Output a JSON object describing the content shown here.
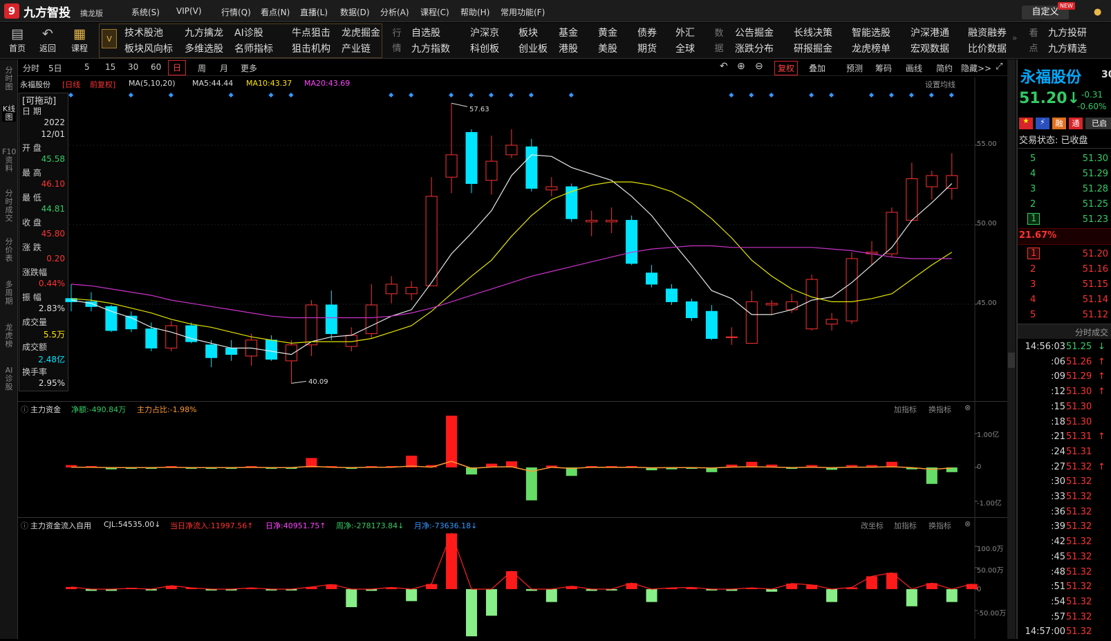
{
  "app": {
    "name": "九方智投",
    "edition": "擒龙版",
    "custom": "自定义",
    "new_badge": "NEW",
    "menus": [
      "系统(S)",
      "VIP(V)",
      "行情(Q)",
      "看点(N)",
      "直播(L)",
      "数据(D)",
      "分析(A)",
      "课程(C)",
      "帮助(H)",
      "常用功能(F)"
    ]
  },
  "toolbar": {
    "home": "首页",
    "back": "返回",
    "course": "课程",
    "group1": [
      "技术股池",
      "九方擒龙",
      "AI诊股",
      "牛点狙击",
      "龙虎掘金",
      "板块风向标",
      "多维选股",
      "名师指标",
      "狙击机构",
      "产业链"
    ],
    "quote_label": "行情",
    "group2": [
      "自选股",
      "沪深京",
      "板块",
      "基金",
      "黄金",
      "债券",
      "外汇",
      "九方指数",
      "科创板",
      "创业板",
      "港股",
      "美股",
      "期货",
      "全球"
    ],
    "data_label": "数据",
    "group3": [
      "公告掘金",
      "长线决策",
      "智能选股",
      "沪深港通",
      "融资融券",
      "涨跌分布",
      "研报掘金",
      "龙虎榜单",
      "宏观数据",
      "比价数据"
    ],
    "view_label": "看点",
    "group4": [
      "九方投研",
      "九方精选"
    ]
  },
  "chart_toolbar": {
    "periods": [
      "分时",
      "5日",
      "5",
      "15",
      "30",
      "60",
      "日",
      "周",
      "月",
      "更多"
    ],
    "tools": [
      "复权",
      "叠加",
      "预测",
      "筹码",
      "画线",
      "简约",
      "隐藏>>"
    ]
  },
  "left_nav": [
    "分时图",
    "K线图",
    "F10资料",
    "分时成交",
    "分价表",
    "多周期",
    "龙虎榜",
    "AI诊股"
  ],
  "kline": {
    "stock": "永福股份",
    "period": "[日线",
    "adj": "前复权]",
    "ma_label": "MA(5,10,20)",
    "ma5": "MA5:44.44",
    "ma10": "MA10:43.37",
    "ma20": "MA20:43.69",
    "settings": "设置均线",
    "high_label": "57.63",
    "low_label": "40.09",
    "y_ticks": [
      "55.00",
      "50.00",
      "45.00"
    ]
  },
  "info": {
    "drag": "[可拖动]",
    "date_label": "日 期",
    "year": "2022",
    "date": "12/01",
    "open_label": "开 盘",
    "open": "45.58",
    "high_label": "最 高",
    "high": "46.10",
    "low_label": "最 低",
    "low": "44.81",
    "close_label": "收 盘",
    "close": "45.80",
    "change_label": "涨 跌",
    "change": "0.20",
    "pct_label": "涨跌幅",
    "pct": "0.44%",
    "amp_label": "振 幅",
    "amp": "2.83%",
    "vol_label": "成交量",
    "vol": "5.5万",
    "amt_label": "成交额",
    "amt": "2.48亿",
    "turn_label": "换手率",
    "turn": "2.95%"
  },
  "panel1": {
    "title": "主力资金",
    "net": "净额:-490.84万",
    "ratio": "主力占比:-1.98%",
    "add": "加指标",
    "switch": "换指标",
    "y_ticks": [
      "1.00亿",
      "0",
      "-1.00亿"
    ]
  },
  "panel2": {
    "title": "主力资金流入自用",
    "cjl": "CJL:54535.00↓",
    "today": "当日净流入:11997.56↑",
    "day": "日净:40951.75↑",
    "week": "周净:-278173.84↓",
    "month": "月净:-73636.18↓",
    "coord": "改坐标",
    "add": "加指标",
    "switch": "换指标",
    "y_ticks": [
      "100.0万",
      "50.00万",
      "0",
      "-50.00万"
    ]
  },
  "quote": {
    "name": "永福股份",
    "code": "30",
    "price": "51.20↓",
    "chg": "-0.31",
    "pct": "-0.60%",
    "status": "交易状态: 已收盘",
    "commission": "21.67%",
    "sub_title": "分时成交",
    "flags": [
      "",
      "",
      "融",
      "通",
      "已启"
    ],
    "asks": [
      {
        "n": "5",
        "p": "51.30"
      },
      {
        "n": "4",
        "p": "51.29"
      },
      {
        "n": "3",
        "p": "51.28"
      },
      {
        "n": "2",
        "p": "51.25"
      },
      {
        "n": "1",
        "p": "51.23"
      }
    ],
    "bids": [
      {
        "n": "1",
        "p": "51.20"
      },
      {
        "n": "2",
        "p": "51.16"
      },
      {
        "n": "3",
        "p": "51.15"
      },
      {
        "n": "4",
        "p": "51.14"
      },
      {
        "n": "5",
        "p": "51.12"
      }
    ],
    "ticks": [
      {
        "t": "14:56:03",
        "p": "51.25",
        "a": "↓",
        "c": "green"
      },
      {
        "t": ":06",
        "p": "51.26",
        "a": "↑",
        "c": "red"
      },
      {
        "t": ":09",
        "p": "51.29",
        "a": "↑",
        "c": "red"
      },
      {
        "t": ":12",
        "p": "51.30",
        "a": "↑",
        "c": "red"
      },
      {
        "t": ":15",
        "p": "51.30",
        "a": "",
        "c": "red"
      },
      {
        "t": ":18",
        "p": "51.30",
        "a": "",
        "c": "red"
      },
      {
        "t": ":21",
        "p": "51.31",
        "a": "↑",
        "c": "red"
      },
      {
        "t": ":24",
        "p": "51.31",
        "a": "",
        "c": "red"
      },
      {
        "t": ":27",
        "p": "51.32",
        "a": "↑",
        "c": "red"
      },
      {
        "t": ":30",
        "p": "51.32",
        "a": "",
        "c": "red"
      },
      {
        "t": ":33",
        "p": "51.32",
        "a": "",
        "c": "red"
      },
      {
        "t": ":36",
        "p": "51.32",
        "a": "",
        "c": "red"
      },
      {
        "t": ":39",
        "p": "51.32",
        "a": "",
        "c": "red"
      },
      {
        "t": ":42",
        "p": "51.32",
        "a": "",
        "c": "red"
      },
      {
        "t": ":45",
        "p": "51.32",
        "a": "",
        "c": "red"
      },
      {
        "t": ":48",
        "p": "51.32",
        "a": "",
        "c": "red"
      },
      {
        "t": ":51",
        "p": "51.32",
        "a": "",
        "c": "red"
      },
      {
        "t": ":54",
        "p": "51.32",
        "a": "",
        "c": "red"
      },
      {
        "t": ":57",
        "p": "51.32",
        "a": "",
        "c": "red"
      },
      {
        "t": "14:57:00",
        "p": "51.32",
        "a": "",
        "c": "red"
      }
    ]
  },
  "chart_data": {
    "type": "candlestick",
    "candles": [
      [
        45.4,
        45.2,
        46.3,
        44.6
      ],
      [
        45.2,
        44.9,
        45.8,
        44.6
      ],
      [
        44.9,
        43.4,
        45.0,
        43.3
      ],
      [
        44.3,
        43.5,
        44.6,
        43.3
      ],
      [
        43.5,
        42.3,
        43.9,
        42.1
      ],
      [
        42.3,
        43.7,
        44.0,
        42.1
      ],
      [
        43.7,
        42.7,
        43.9,
        42.6
      ],
      [
        42.5,
        41.7,
        42.8,
        41.1
      ],
      [
        42.3,
        41.9,
        42.8,
        41.5
      ],
      [
        41.8,
        42.8,
        43.2,
        41.2
      ],
      [
        42.8,
        41.6,
        43.1,
        41.5
      ],
      [
        41.5,
        42.5,
        42.8,
        40.09
      ],
      [
        42.5,
        45.0,
        45.3,
        41.8
      ],
      [
        45.0,
        43.2,
        45.9,
        42.8
      ],
      [
        42.4,
        43.1,
        43.6,
        42.1
      ],
      [
        43.2,
        45.0,
        46.3,
        42.9
      ],
      [
        45.7,
        46.3,
        46.8,
        45.1
      ],
      [
        45.7,
        46.1,
        46.5,
        45.3
      ],
      [
        46.2,
        51.8,
        53.0,
        46.2
      ],
      [
        53.0,
        54.4,
        57.63,
        52.0
      ],
      [
        55.8,
        52.6,
        56.0,
        52.0
      ],
      [
        52.8,
        54.0,
        55.6,
        51.9
      ],
      [
        54.4,
        55.0,
        56.0,
        54.2
      ],
      [
        54.9,
        52.3,
        55.4,
        52.1
      ],
      [
        52.2,
        52.4,
        53.0,
        51.8
      ],
      [
        52.4,
        50.4,
        52.6,
        50.2
      ],
      [
        50.2,
        50.3,
        50.9,
        49.3
      ],
      [
        50.2,
        50.3,
        51.1,
        49.5
      ],
      [
        50.3,
        47.6,
        50.6,
        47.5
      ],
      [
        47.0,
        46.3,
        47.5,
        46.1
      ],
      [
        46.0,
        45.2,
        46.3,
        45.0
      ],
      [
        45.2,
        44.2,
        45.4,
        44.0
      ],
      [
        44.6,
        42.9,
        45.0,
        42.8
      ],
      [
        43.0,
        43.0,
        43.6,
        42.5
      ],
      [
        42.6,
        45.2,
        45.9,
        42.6
      ],
      [
        45.0,
        45.1,
        45.3,
        44.4
      ],
      [
        44.7,
        45.2,
        45.7,
        44.5
      ],
      [
        43.5,
        46.6,
        46.9,
        43.4
      ],
      [
        43.8,
        44.1,
        44.5,
        43.4
      ],
      [
        44.0,
        47.9,
        48.3,
        43.8
      ],
      [
        48.2,
        48.3,
        49.0,
        47.5
      ],
      [
        48.2,
        50.8,
        51.1,
        48.0
      ],
      [
        50.3,
        52.9,
        53.9,
        50.3
      ],
      [
        52.4,
        53.1,
        53.4,
        51.6
      ],
      [
        52.3,
        53.1,
        54.5,
        51.6
      ]
    ],
    "ma5": [
      45.3,
      45.1,
      44.6,
      44.2,
      43.6,
      43.3,
      42.9,
      42.6,
      42.3,
      42.3,
      42.1,
      41.9,
      42.7,
      43.0,
      43.1,
      43.7,
      44.3,
      44.7,
      46.4,
      48.2,
      49.5,
      50.9,
      53.1,
      54.4,
      54.3,
      53.6,
      53.2,
      52.8,
      51.8,
      50.6,
      49.0,
      47.5,
      45.9,
      45.4,
      44.4,
      44.4,
      44.7,
      45.3,
      45.5,
      46.4,
      47.5,
      48.6,
      50.3,
      51.4,
      52.6
    ],
    "ma10": [
      45.4,
      45.3,
      45.1,
      44.8,
      44.5,
      44.1,
      43.8,
      43.6,
      43.3,
      43.0,
      42.8,
      42.6,
      42.7,
      42.7,
      42.7,
      42.9,
      43.3,
      43.7,
      44.6,
      45.7,
      46.8,
      47.8,
      49.3,
      50.6,
      51.6,
      52.1,
      52.5,
      52.7,
      52.7,
      52.5,
      52.1,
      51.4,
      50.4,
      49.2,
      47.8,
      46.8,
      46.0,
      45.5,
      45.2,
      45.2,
      45.4,
      45.7,
      46.6,
      47.5,
      48.3
    ],
    "ma20": [
      46.3,
      46.2,
      46.0,
      45.8,
      45.6,
      45.3,
      45.1,
      44.9,
      44.7,
      44.5,
      44.3,
      44.2,
      44.2,
      44.2,
      44.2,
      44.2,
      44.3,
      44.5,
      44.8,
      45.2,
      45.6,
      46.0,
      46.4,
      46.8,
      47.1,
      47.4,
      47.7,
      48.0,
      48.3,
      48.5,
      48.6,
      48.7,
      48.7,
      48.6,
      48.6,
      48.6,
      48.6,
      48.6,
      48.5,
      48.4,
      48.2,
      48.0,
      47.9,
      47.9,
      47.9
    ],
    "main_funds": [
      0.05,
      0.03,
      -0.04,
      -0.03,
      -0.02,
      0.02,
      -0.02,
      -0.03,
      -0.02,
      0.01,
      -0.02,
      -0.03,
      0.2,
      0.02,
      -0.02,
      0.02,
      0.03,
      0.25,
      0.05,
      1.1,
      -0.15,
      0.08,
      0.13,
      -0.7,
      0.04,
      -0.18,
      0.02,
      0.01,
      0.03,
      -0.06,
      -0.04,
      -0.02,
      -0.1,
      0.06,
      0.12,
      0.06,
      -0.03,
      0.05,
      -0.05,
      0.05,
      0.05,
      0.12,
      -0.04,
      -0.35,
      -0.1
    ],
    "flow": [
      5,
      -4,
      -4,
      2,
      -3,
      8,
      3,
      -2,
      -3,
      3,
      -2,
      -3,
      5,
      11,
      -42,
      -4,
      4,
      -28,
      12,
      130,
      -110,
      -62,
      42,
      -4,
      -30,
      7,
      -4,
      -2,
      14,
      -30,
      3,
      4,
      -3,
      -4,
      3,
      -6,
      13,
      10,
      -30,
      4,
      30,
      38,
      -40,
      14,
      -30,
      12
    ]
  }
}
